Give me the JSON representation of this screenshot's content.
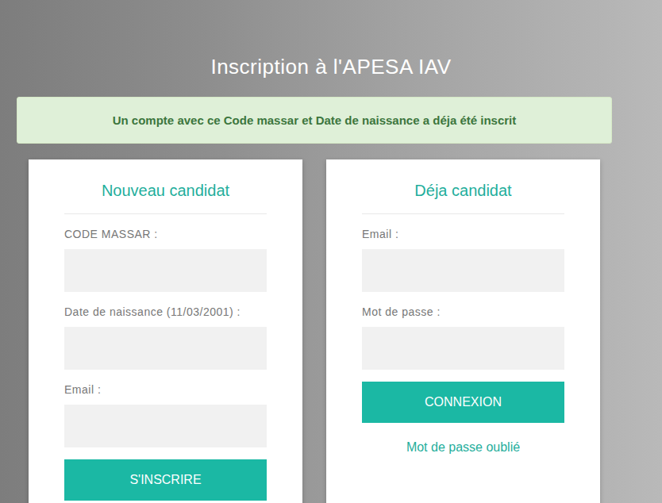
{
  "page": {
    "title": "Inscription à l'APESA IAV"
  },
  "alert": {
    "text": "Un compte avec ce Code massar et Date de naissance a déja été inscrit"
  },
  "new_candidate": {
    "title": "Nouveau candidat",
    "fields": [
      {
        "label": "CODE MASSAR :",
        "value": ""
      },
      {
        "label": "Date de naissance (11/03/2001) :",
        "value": ""
      },
      {
        "label": "Email :",
        "value": ""
      }
    ],
    "button": "S'INSCRIRE"
  },
  "existing_candidate": {
    "title": "Déja candidat",
    "fields": [
      {
        "label": "Email :",
        "value": ""
      },
      {
        "label": "Mot de passe :",
        "value": ""
      }
    ],
    "button": "CONNEXION",
    "link": "Mot de passe oublié"
  }
}
